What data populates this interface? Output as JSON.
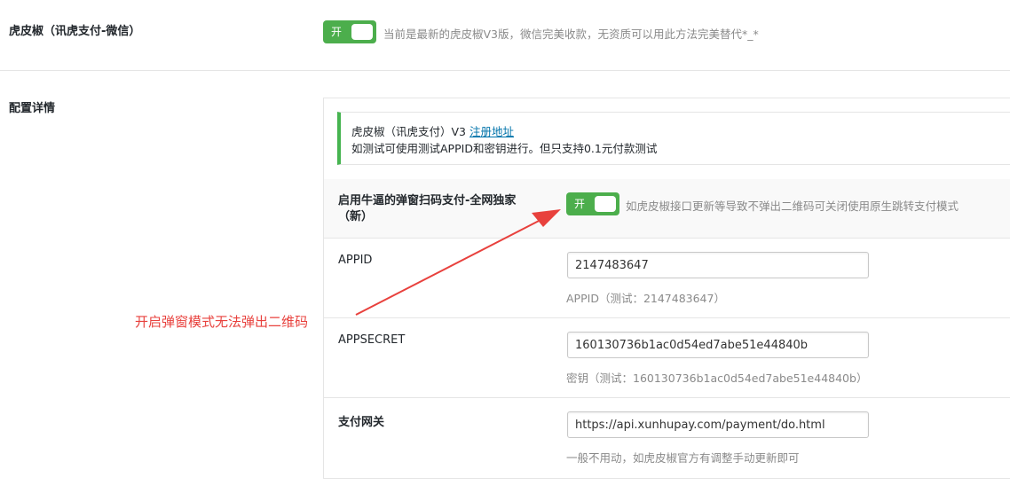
{
  "top_setting": {
    "label": "虎皮椒（讯虎支付-微信）",
    "toggle_label": "开",
    "description": "当前是最新的虎皮椒V3版，微信完美收款，无资质可以用此方法完美替代*_*"
  },
  "config": {
    "label": "配置详情",
    "notice": {
      "line1_text": "虎皮椒（讯虎支付）V3 ",
      "line1_link": "注册地址",
      "line2_text": "如测试可使用测试APPID和密钥进行。但只支持0.1元付款测试"
    },
    "popup": {
      "label_line1": "启用牛逼的弹窗扫码支付-全网独家",
      "label_line2": "（新）",
      "toggle_label": "开",
      "description": "如虎皮椒接口更新等导致不弹出二维码可关闭使用原生跳转支付模式"
    },
    "appid": {
      "label": "APPID",
      "value": "2147483647",
      "hint": "APPID（测试：2147483647）"
    },
    "appsecret": {
      "label": "APPSECRET",
      "value": "160130736b1ac0d54ed7abe51e44840b",
      "hint": "密钥（测试：160130736b1ac0d54ed7abe51e44840b）"
    },
    "gateway": {
      "label": "支付网关",
      "value": "https://api.xunhupay.com/payment/do.html",
      "hint": "一般不用动，如虎皮椒官方有调整手动更新即可"
    }
  },
  "annotation": {
    "text": "开启弹窗模式无法弹出二维码",
    "color": "#e8413d"
  },
  "colors": {
    "toggle_on": "#4cae4c",
    "notice_border": "#46b450",
    "link": "#0073aa"
  }
}
